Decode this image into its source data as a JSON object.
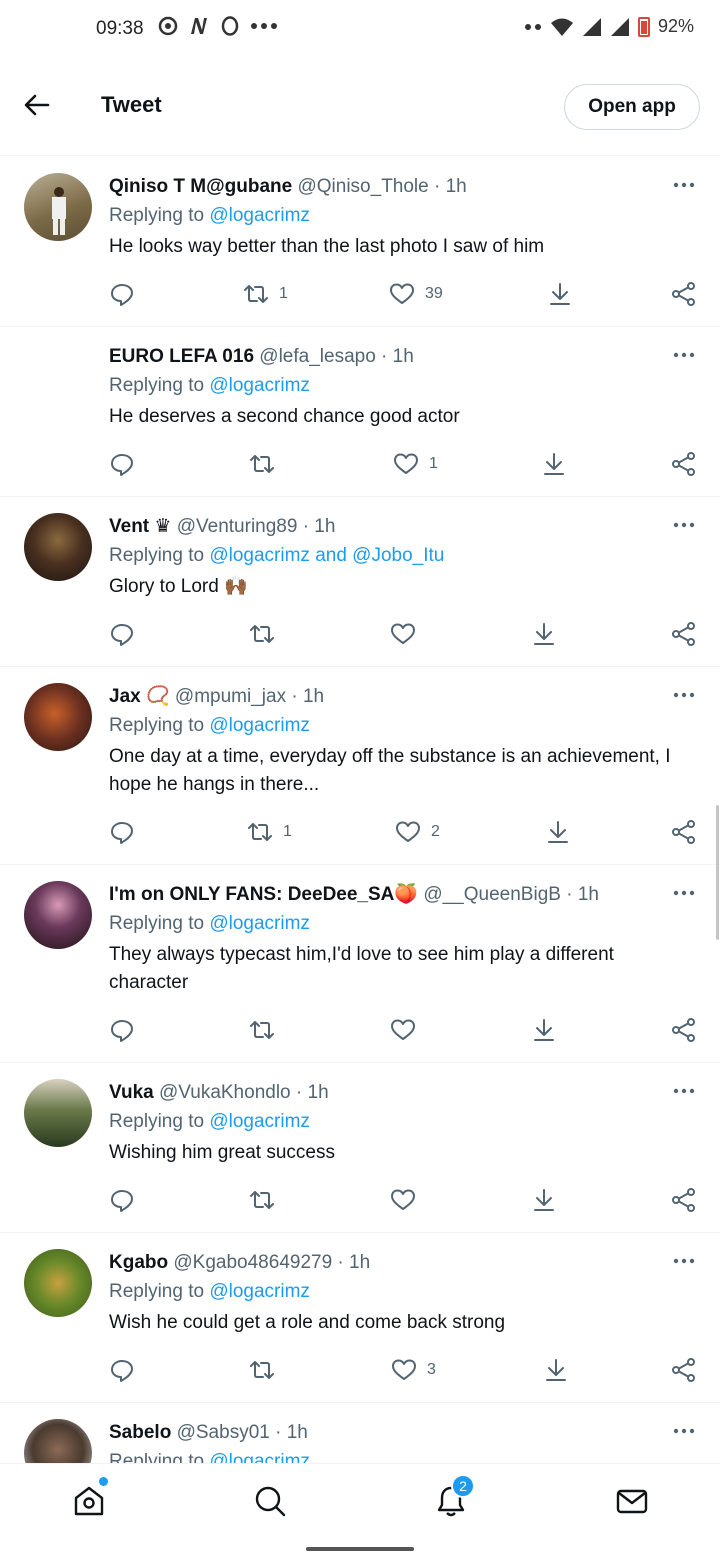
{
  "status_bar": {
    "time": "09:38",
    "battery": "92%"
  },
  "header": {
    "title": "Tweet",
    "open_app": "Open app"
  },
  "tweets": [
    {
      "name": "Qiniso T M@gubane",
      "handle": "@Qiniso_Thole · 1h",
      "replying_prefix": "Replying to ",
      "replying_to": "@logacrimz",
      "text": "He looks way better than the last photo I saw of him",
      "retweets": "1",
      "likes": "39",
      "avatar_color": "#8a7a5a"
    },
    {
      "name": "EURO LEFA 016",
      "handle": "@lefa_lesapo · 1h",
      "replying_prefix": "Replying to ",
      "replying_to": "@logacrimz",
      "text": "He deserves a second chance good actor",
      "retweets": "",
      "likes": "1",
      "avatar_color": "#ffffff"
    },
    {
      "name": "Vent ♛",
      "handle": "@Venturing89 · 1h",
      "replying_prefix": "Replying to ",
      "replying_to": "@logacrimz and @Jobo_Itu",
      "text": "Glory to Lord 🙌🏾",
      "retweets": "",
      "likes": "",
      "avatar_color": "#3b2a20"
    },
    {
      "name": "Jax 📿",
      "handle": "@mpumi_jax · 1h",
      "replying_prefix": "Replying to ",
      "replying_to": "@logacrimz",
      "text": "One day at a time, everyday off the substance is an achievement, I hope he hangs in there...",
      "retweets": "1",
      "likes": "2",
      "avatar_color": "#6b3a2a"
    },
    {
      "name": "I'm on ONLY FANS: DeeDee_SA🍑",
      "handle": "@__QueenBigB · 1h",
      "replying_prefix": "Replying to ",
      "replying_to": "@logacrimz",
      "text": "They always typecast him,I'd love to see him play a different character",
      "retweets": "",
      "likes": "",
      "avatar_color": "#2a1a2a"
    },
    {
      "name": "Vuka",
      "handle": "@VukaKhondlo · 1h",
      "replying_prefix": "Replying to ",
      "replying_to": "@logacrimz",
      "text": "Wishing him great success",
      "retweets": "",
      "likes": "",
      "avatar_color": "#4a5a3a"
    },
    {
      "name": "Kgabo",
      "handle": "@Kgabo48649279 · 1h",
      "replying_prefix": "Replying to ",
      "replying_to": "@logacrimz",
      "text": "Wish he could get a role and come back strong",
      "retweets": "",
      "likes": "3",
      "avatar_color": "#6a8a2a"
    },
    {
      "name": "Sabelo",
      "handle": "@Sabsy01 · 1h",
      "replying_prefix": "Replying to ",
      "replying_to": "@logacrimz",
      "text": "",
      "retweets": "",
      "likes": "",
      "avatar_color": "#4a3a30"
    }
  ],
  "nav": {
    "notifications_badge": "2"
  },
  "colors": {
    "accent": "#1d9bf0",
    "secondary_text": "#536471",
    "primary_text": "#0f1419"
  }
}
